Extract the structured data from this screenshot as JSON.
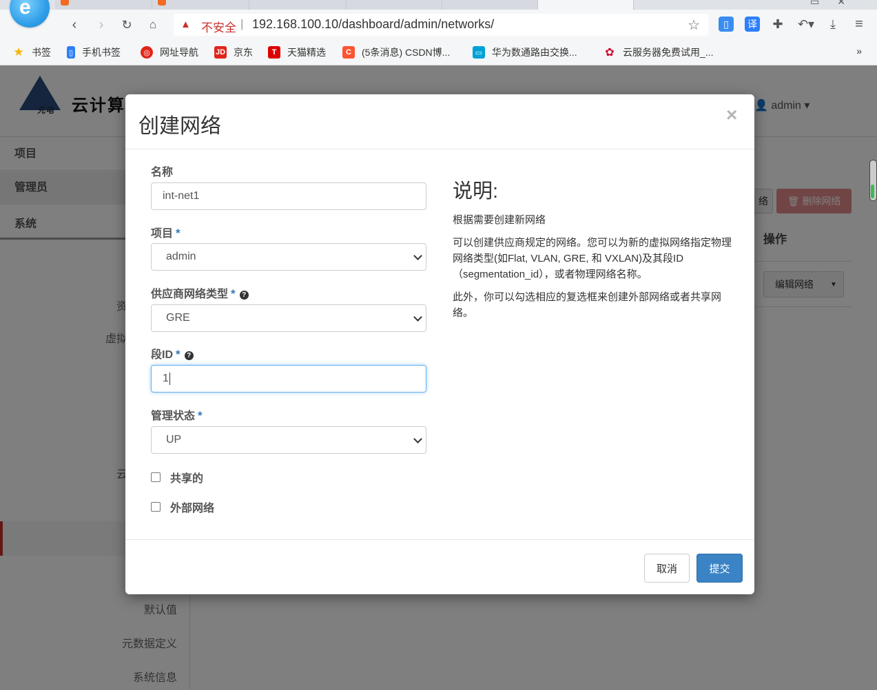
{
  "browser": {
    "address_warning": "不安全",
    "url": "192.168.100.10/dashboard/admin/networks/",
    "bookmarks": [
      {
        "label": "书签",
        "icon": "star-icon",
        "color": "#f5b400"
      },
      {
        "label": "手机书签",
        "icon": "phone-icon",
        "color": "#2d7ff9"
      },
      {
        "label": "网址导航",
        "icon": "nav-icon",
        "color": "#e2261a"
      },
      {
        "label": "京东",
        "icon": "jd-icon",
        "color": "#e2231a"
      },
      {
        "label": "天猫精选",
        "icon": "tmall-icon",
        "color": "#d00"
      },
      {
        "label": "(5条消息) CSDN博...",
        "icon": "csdn-icon",
        "color": "#fc5531"
      },
      {
        "label": "华为数通路由交换...",
        "icon": "bilibili-icon",
        "color": "#00a1d6"
      },
      {
        "label": "云服务器免费试用_...",
        "icon": "huawei-icon",
        "color": "#cf0a2c"
      }
    ],
    "bookmarks_more": "»"
  },
  "app": {
    "logo_text": "云计算",
    "logo_sub": "先电",
    "user": "admin",
    "sidebar": {
      "project": "项目",
      "admin": "管理员",
      "system": "系统",
      "items": [
        "默认值",
        "元数据定义",
        "系统信息"
      ],
      "partial": [
        "资",
        "虚拟",
        "云"
      ]
    },
    "content": {
      "actions_header": "操作",
      "delete_networks": "删除网络",
      "partial_button": "络",
      "edit_network": "编辑网络"
    }
  },
  "modal": {
    "title": "创建网络",
    "close": "×",
    "fields": {
      "name": {
        "label": "名称",
        "value": "int-net1"
      },
      "project": {
        "label": "项目",
        "value": "admin"
      },
      "provider_type": {
        "label": "供应商网络类型",
        "value": "GRE"
      },
      "segment_id": {
        "label": "段ID",
        "value": "1"
      },
      "admin_state": {
        "label": "管理状态",
        "value": "UP"
      }
    },
    "checkboxes": {
      "shared": "共享的",
      "external": "外部网络"
    },
    "required_mark": "*",
    "help_mark": "?",
    "description": {
      "title": "说明:",
      "p1": "根据需要创建新网络",
      "p2": "可以创建供应商规定的网络。您可以为新的虚拟网络指定物理网络类型(如Flat, VLAN, GRE, 和 VXLAN)及其段ID（segmentation_id），或者物理网络名称。",
      "p3": "此外，你可以勾选相应的复选框来创建外部网络或者共享网络。"
    },
    "buttons": {
      "cancel": "取消",
      "submit": "提交"
    }
  },
  "colors": {
    "primary": "#3a84c6",
    "danger_faded": "#e38b8a",
    "required": "#337ab7"
  }
}
